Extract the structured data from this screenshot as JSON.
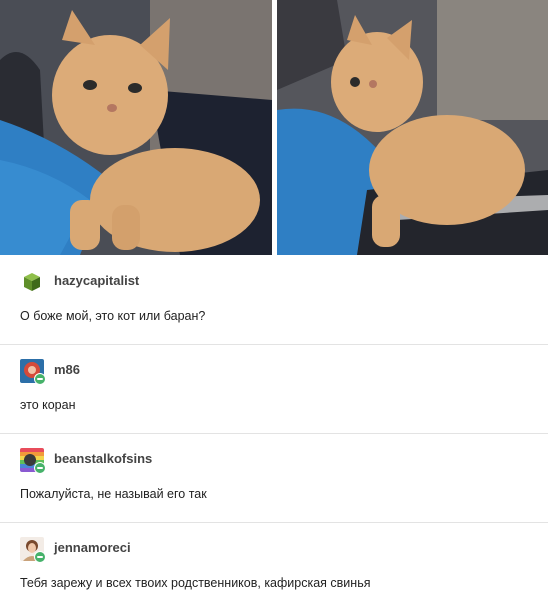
{
  "posts": [
    {
      "username": "hazycapitalist",
      "text": "О боже мой, это кот или баран?",
      "avatar_icon": "green-box-icon"
    },
    {
      "username": "m86",
      "text": "это коран",
      "avatar_icon": "red-circle-avatar-icon"
    },
    {
      "username": "beanstalkofsins",
      "text": "Пожалуйста, не называй его так",
      "avatar_icon": "rainbow-avatar-icon"
    },
    {
      "username": "jennamoreci",
      "text": "Тебя зарежу и всех твоих родственников, кафирская свинья",
      "avatar_icon": "photo-avatar-icon"
    }
  ],
  "colors": {
    "follow_badge": "#46b26a",
    "divider": "#e3e3e3",
    "kitten_fur": "#d9a874",
    "blanket": "#2f7fc4"
  }
}
